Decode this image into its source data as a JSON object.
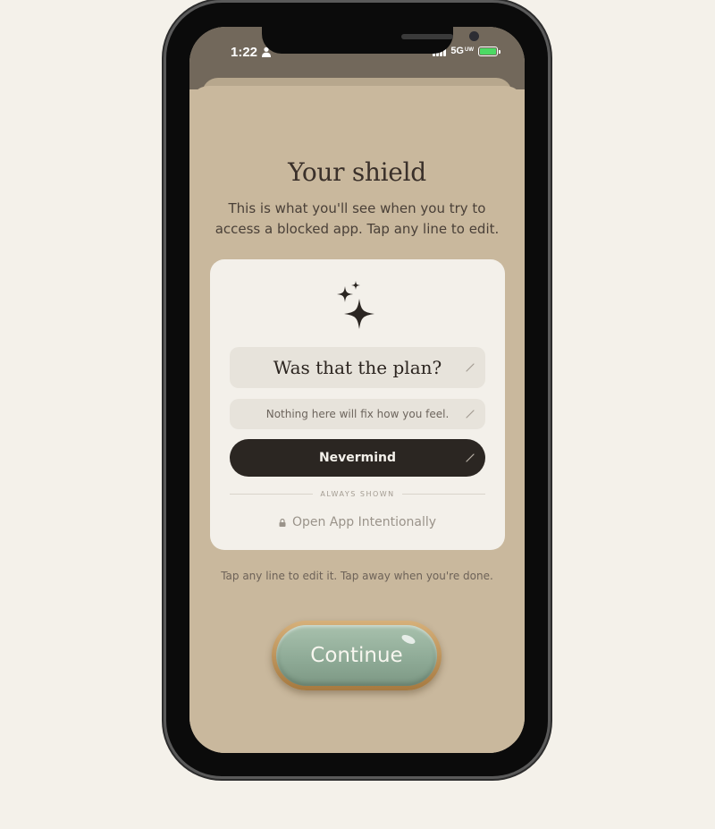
{
  "status_bar": {
    "time": "1:22",
    "network": "5G",
    "network_sup": "UW"
  },
  "screen": {
    "title": "Your shield",
    "subtitle": "This is what you'll see when you try to access a blocked app. Tap any line to edit.",
    "shield_card": {
      "icon": "sparkles-icon",
      "headline": "Was that the plan?",
      "message": "Nothing here will fix how you feel.",
      "dismiss_label": "Nevermind",
      "divider_label": "ALWAYS SHOWN",
      "open_label": "Open App Intentionally"
    },
    "hint": "Tap any line to edit it. Tap away when you're done.",
    "continue_label": "Continue"
  },
  "colors": {
    "background": "#f4f1ea",
    "sheet": "#c9b89d",
    "card": "#f3f0ea",
    "dark_button": "#2b2622",
    "continue_green": "#8fab97",
    "continue_gold": "#c49b60"
  }
}
